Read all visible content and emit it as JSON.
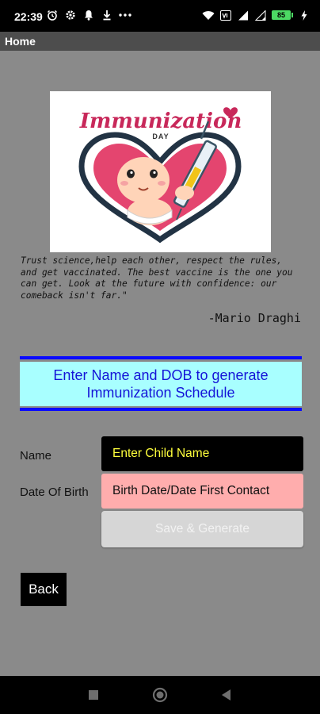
{
  "status_bar": {
    "time": "22:39",
    "left_icons": [
      "alarm-icon",
      "settings-icon",
      "notification-icon",
      "download-icon",
      "more-dots-icon"
    ],
    "right_icons": [
      "wifi-icon",
      "vowifi-icon",
      "signal-icon",
      "signal-icon-2",
      "battery-icon",
      "charging-icon"
    ],
    "battery": "85"
  },
  "app_bar": {
    "title": "Home"
  },
  "hero": {
    "title": "Immunization",
    "subtitle": "DAY"
  },
  "quote": {
    "text": "Trust science,help each other, respect the rules, and get vaccinated. The best vaccine is the one you can get. Look at the future with confidence: our comeback isn't far.\"",
    "author": "-Mario Draghi"
  },
  "banner": {
    "text": "Enter Name and DOB to generate\nImmunization Schedule"
  },
  "form": {
    "name_label": "Name",
    "name_placeholder": "Enter Child Name",
    "dob_label": "Date Of Birth",
    "dob_value": "Birth Date/Date First Contact",
    "save_label": "Save & Generate"
  },
  "back_label": "Back",
  "colors": {
    "background": "#8a8a8a",
    "banner_bg": "#a8ffff",
    "banner_text": "#1414d8",
    "banner_border": "#0a0aff",
    "name_text": "#ffff3c",
    "dob_bg": "#ffadad"
  },
  "nav": [
    "recent-apps-icon",
    "home-icon",
    "back-icon"
  ]
}
